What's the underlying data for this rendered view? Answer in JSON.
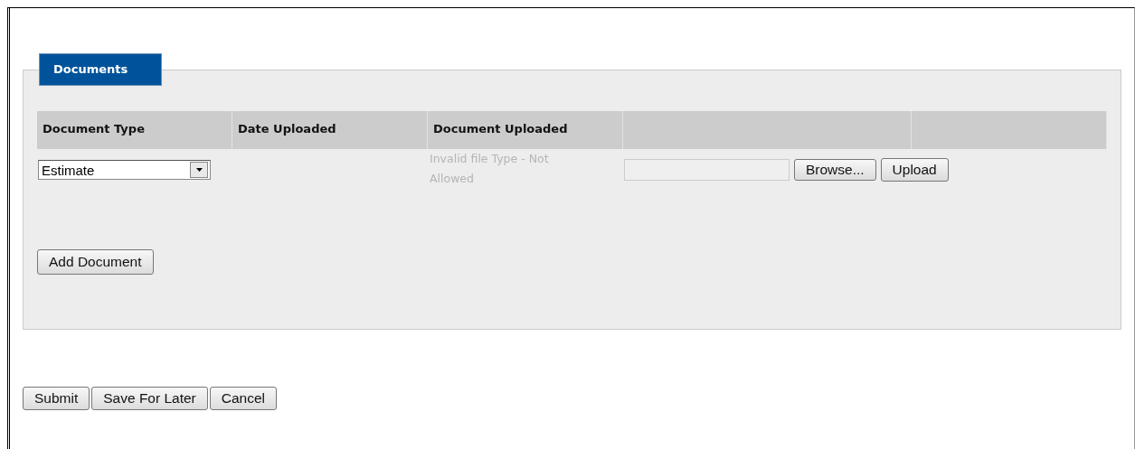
{
  "tab": {
    "label": "Documents",
    "selected": true
  },
  "table": {
    "columns": [
      "Document Type",
      "Date Uploaded",
      "Document Uploaded"
    ],
    "rows": [
      {
        "document_type": "Estimate",
        "status": "Invalid file Type - Not Allowed",
        "browse": "Browse...",
        "upload": "Upload"
      }
    ]
  },
  "add_button": "Add Document",
  "buttons": [
    "Submit",
    "Save For Later",
    "Cancel"
  ]
}
